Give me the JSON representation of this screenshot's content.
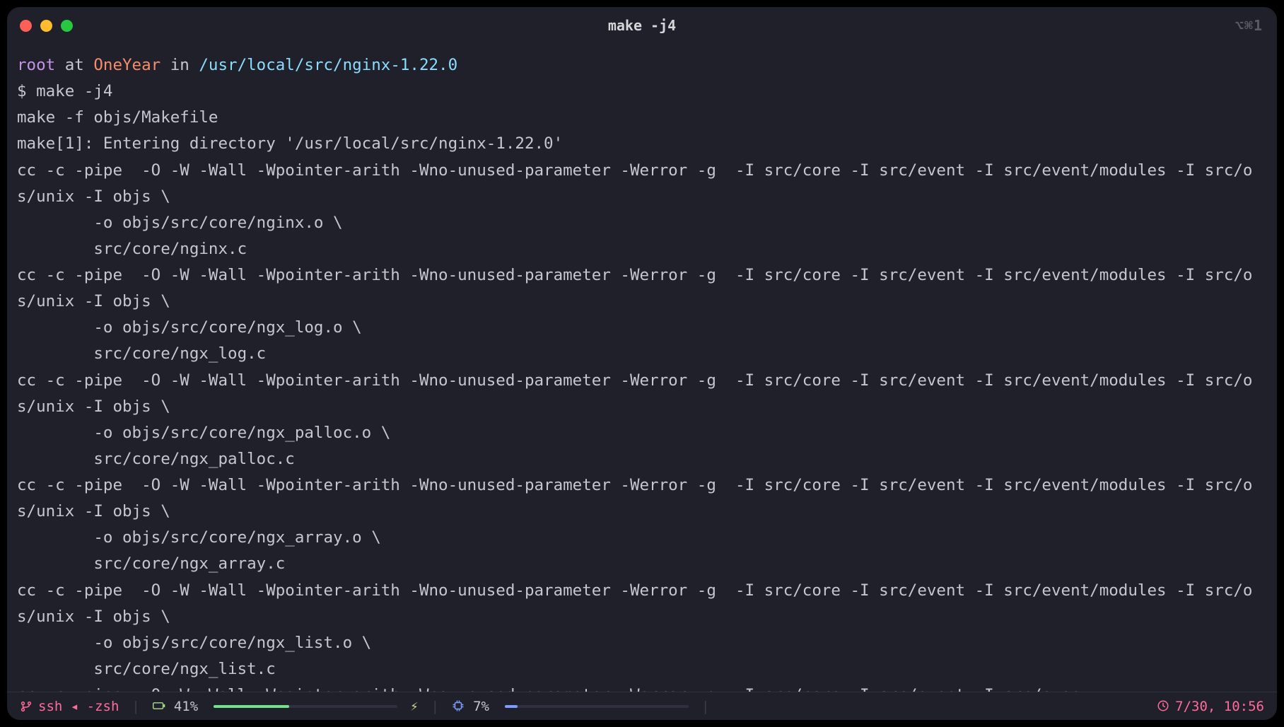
{
  "window": {
    "title": "make -j4",
    "right_hint": "⌥⌘1"
  },
  "prompt": {
    "user": "root",
    "at": " at ",
    "host": "OneYear",
    "in": " in ",
    "path": "/usr/local/src/nginx-1.22.0",
    "ps1": "$ ",
    "command": "make -j4"
  },
  "output_lines": [
    "make -f objs/Makefile",
    "make[1]: Entering directory '/usr/local/src/nginx-1.22.0'",
    "cc -c -pipe  -O -W -Wall -Wpointer-arith -Wno-unused-parameter -Werror -g  -I src/core -I src/event -I src/event/modules -I src/os/unix -I objs \\",
    "        -o objs/src/core/nginx.o \\",
    "        src/core/nginx.c",
    "cc -c -pipe  -O -W -Wall -Wpointer-arith -Wno-unused-parameter -Werror -g  -I src/core -I src/event -I src/event/modules -I src/os/unix -I objs \\",
    "        -o objs/src/core/ngx_log.o \\",
    "        src/core/ngx_log.c",
    "cc -c -pipe  -O -W -Wall -Wpointer-arith -Wno-unused-parameter -Werror -g  -I src/core -I src/event -I src/event/modules -I src/os/unix -I objs \\",
    "        -o objs/src/core/ngx_palloc.o \\",
    "        src/core/ngx_palloc.c",
    "cc -c -pipe  -O -W -Wall -Wpointer-arith -Wno-unused-parameter -Werror -g  -I src/core -I src/event -I src/event/modules -I src/os/unix -I objs \\",
    "        -o objs/src/core/ngx_array.o \\",
    "        src/core/ngx_array.c",
    "cc -c -pipe  -O -W -Wall -Wpointer-arith -Wno-unused-parameter -Werror -g  -I src/core -I src/event -I src/event/modules -I src/os/unix -I objs \\",
    "        -o objs/src/core/ngx_list.o \\",
    "        src/core/ngx_list.c",
    "cc -c -pipe  -O -W -Wall -Wpointer-arith -Wno-unused-parameter -Werror -g  -I src/core -I src/event -I src/even"
  ],
  "status": {
    "left": "ssh ◂ -zsh",
    "battery_pct": "41%",
    "battery_fill": "41%",
    "cpu_pct": "7%",
    "cpu_fill": "7%",
    "clock": "7/30, 10:56"
  }
}
